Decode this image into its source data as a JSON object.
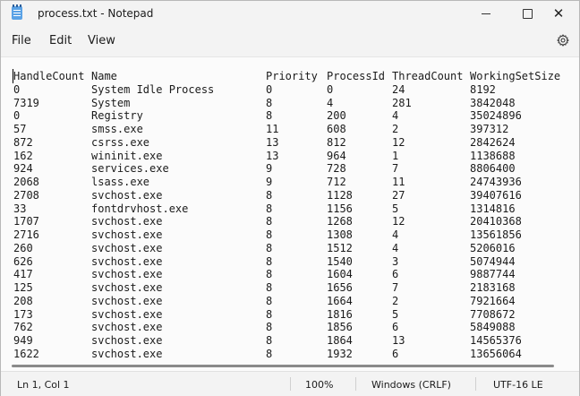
{
  "window": {
    "title": "process.txt - Notepad"
  },
  "menu": {
    "file": "File",
    "edit": "Edit",
    "view": "View"
  },
  "table": {
    "header": [
      "HandleCount",
      "Name",
      "Priority",
      "ProcessId",
      "ThreadCount",
      "WorkingSetSize"
    ],
    "rows": [
      [
        "0",
        "System Idle Process",
        "0",
        "0",
        "24",
        "8192"
      ],
      [
        "7319",
        "System",
        "8",
        "4",
        "281",
        "3842048"
      ],
      [
        "0",
        "Registry",
        "8",
        "200",
        "4",
        "35024896"
      ],
      [
        "57",
        "smss.exe",
        "11",
        "608",
        "2",
        "397312"
      ],
      [
        "872",
        "csrss.exe",
        "13",
        "812",
        "12",
        "2842624"
      ],
      [
        "162",
        "wininit.exe",
        "13",
        "964",
        "1",
        "1138688"
      ],
      [
        "924",
        "services.exe",
        "9",
        "728",
        "7",
        "8806400"
      ],
      [
        "2068",
        "lsass.exe",
        "9",
        "712",
        "11",
        "24743936"
      ],
      [
        "2708",
        "svchost.exe",
        "8",
        "1128",
        "27",
        "39407616"
      ],
      [
        "33",
        "fontdrvhost.exe",
        "8",
        "1156",
        "5",
        "1314816"
      ],
      [
        "1707",
        "svchost.exe",
        "8",
        "1268",
        "12",
        "20410368"
      ],
      [
        "2716",
        "svchost.exe",
        "8",
        "1308",
        "4",
        "13561856"
      ],
      [
        "260",
        "svchost.exe",
        "8",
        "1512",
        "4",
        "5206016"
      ],
      [
        "626",
        "svchost.exe",
        "8",
        "1540",
        "3",
        "5074944"
      ],
      [
        "417",
        "svchost.exe",
        "8",
        "1604",
        "6",
        "9887744"
      ],
      [
        "125",
        "svchost.exe",
        "8",
        "1656",
        "7",
        "2183168"
      ],
      [
        "208",
        "svchost.exe",
        "8",
        "1664",
        "2",
        "7921664"
      ],
      [
        "173",
        "svchost.exe",
        "8",
        "1816",
        "5",
        "7708672"
      ],
      [
        "762",
        "svchost.exe",
        "8",
        "1856",
        "6",
        "5849088"
      ],
      [
        "949",
        "svchost.exe",
        "8",
        "1864",
        "13",
        "14565376"
      ],
      [
        "1622",
        "svchost.exe",
        "8",
        "1932",
        "6",
        "13656064"
      ]
    ]
  },
  "status": {
    "position": "Ln 1, Col 1",
    "zoom": "100%",
    "line_ending": "Windows (CRLF)",
    "encoding": "UTF-16 LE"
  },
  "icons": {
    "app": "notepad-icon",
    "settings": "gear-icon",
    "minimize": "minimize-icon",
    "maximize": "maximize-icon",
    "close": "close-icon"
  }
}
